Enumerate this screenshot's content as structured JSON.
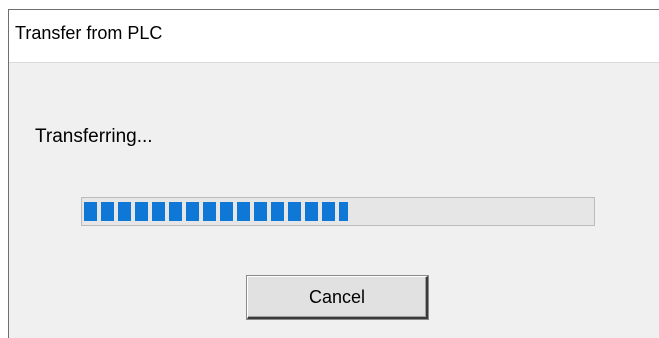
{
  "dialog": {
    "title": "Transfer from PLC",
    "status": "Transferring...",
    "progress_fraction": 0.52,
    "cancel_label": "Cancel"
  },
  "colors": {
    "progress_fill": "#0f78d7",
    "dialog_bg": "#f0f0f0",
    "titlebar_bg": "#ffffff"
  }
}
